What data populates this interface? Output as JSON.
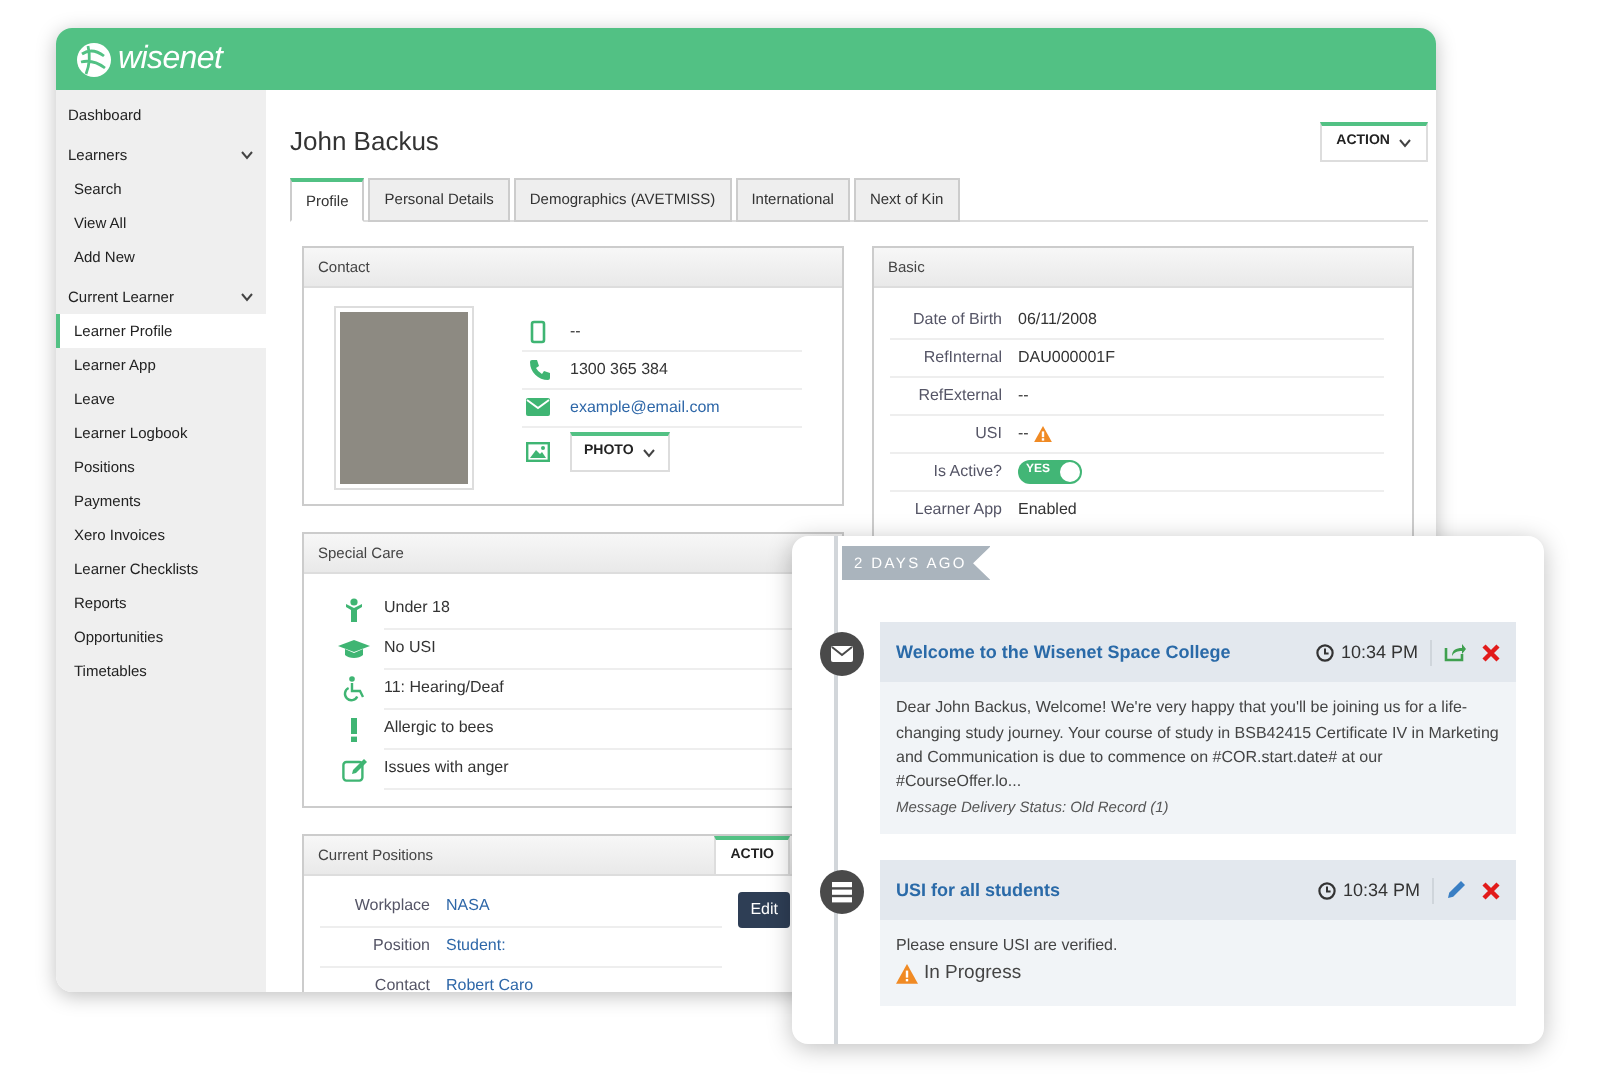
{
  "app": {
    "logo": "wisenet"
  },
  "sidebar": {
    "items": [
      {
        "label": "Dashboard",
        "kind": "link",
        "selected": false
      },
      {
        "label": "Learners",
        "kind": "section",
        "expanded": true,
        "children": [
          {
            "label": "Search",
            "selected": false
          },
          {
            "label": "View All",
            "selected": false
          },
          {
            "label": "Add New",
            "selected": false
          }
        ]
      },
      {
        "label": "Current Learner",
        "kind": "section",
        "expanded": true,
        "children": [
          {
            "label": "Learner Profile",
            "selected": true
          },
          {
            "label": "Learner App",
            "selected": false
          },
          {
            "label": "Leave",
            "selected": false
          },
          {
            "label": "Learner Logbook",
            "selected": false
          },
          {
            "label": "Positions",
            "selected": false
          },
          {
            "label": "Payments",
            "selected": false
          },
          {
            "label": "Xero Invoices",
            "selected": false
          },
          {
            "label": "Learner Checklists",
            "selected": false
          },
          {
            "label": "Reports",
            "selected": false
          },
          {
            "label": "Opportunities",
            "selected": false
          },
          {
            "label": "Timetables",
            "selected": false
          }
        ]
      }
    ]
  },
  "page": {
    "title": "John Backus",
    "action": "ACTION"
  },
  "tabs": [
    {
      "label": "Profile",
      "selected": true
    },
    {
      "label": "Personal Details",
      "selected": false
    },
    {
      "label": "Demographics (AVETMISS)",
      "selected": false
    },
    {
      "label": "International",
      "selected": false
    },
    {
      "label": "Next of Kin",
      "selected": false
    }
  ],
  "contact": {
    "title": "Contact",
    "photo_button": "PHOTO",
    "rows": [
      {
        "kind": "mobile",
        "value": "--"
      },
      {
        "kind": "phone",
        "value": "1300 365 384"
      },
      {
        "kind": "email",
        "value": "example@email.com"
      }
    ]
  },
  "basic": {
    "title": "Basic",
    "fields": [
      {
        "label": "Date of Birth",
        "kind": "text",
        "value": "06/11/2008"
      },
      {
        "label": "RefInternal",
        "kind": "text",
        "value": "DAU000001F"
      },
      {
        "label": "RefExternal",
        "kind": "text",
        "value": "--"
      },
      {
        "label": "USI",
        "kind": "warning",
        "value": "--"
      },
      {
        "label": "Is Active?",
        "kind": "toggle",
        "value": "YES",
        "on": true
      },
      {
        "label": "Learner App",
        "kind": "text",
        "value": "Enabled"
      }
    ]
  },
  "special_care": {
    "title": "Special Care",
    "items": [
      {
        "kind": "age",
        "text": "Under 18"
      },
      {
        "kind": "education",
        "text": "No USI"
      },
      {
        "kind": "disability",
        "text": "11: Hearing/Deaf"
      },
      {
        "kind": "alert",
        "text": "Allergic to bees"
      },
      {
        "kind": "note",
        "text": "Issues with anger"
      }
    ]
  },
  "positions": {
    "title": "Current Positions",
    "action": "ACTIO",
    "edit": "Edit",
    "fields": [
      {
        "label": "Workplace",
        "value": "NASA"
      },
      {
        "label": "Position",
        "value": "Student:"
      },
      {
        "label": "Contact",
        "value": "Robert Caro"
      }
    ]
  },
  "timeline": {
    "date": "2 DAYS AGO",
    "entries": [
      {
        "kind": "message",
        "title": "Welcome to the Wisenet Space College",
        "time": "10:34 PM",
        "actions": [
          {
            "kind": "share"
          },
          {
            "kind": "delete"
          }
        ],
        "body": "Dear John Backus, Welcome! We're very happy that you'll be joining us for a life-changing study journey. Your course of study in BSB42415 Certificate IV in Marketing and Communication is due to commence on #COR.start.date# at our #CourseOffer.lo...",
        "note": "Message Delivery Status: Old Record (1)"
      },
      {
        "kind": "task",
        "title": "USI for all students",
        "time": "10:34 PM",
        "actions": [
          {
            "kind": "edit"
          },
          {
            "kind": "delete"
          }
        ],
        "body": "Please ensure USI are verified.",
        "status": "In Progress"
      }
    ]
  }
}
